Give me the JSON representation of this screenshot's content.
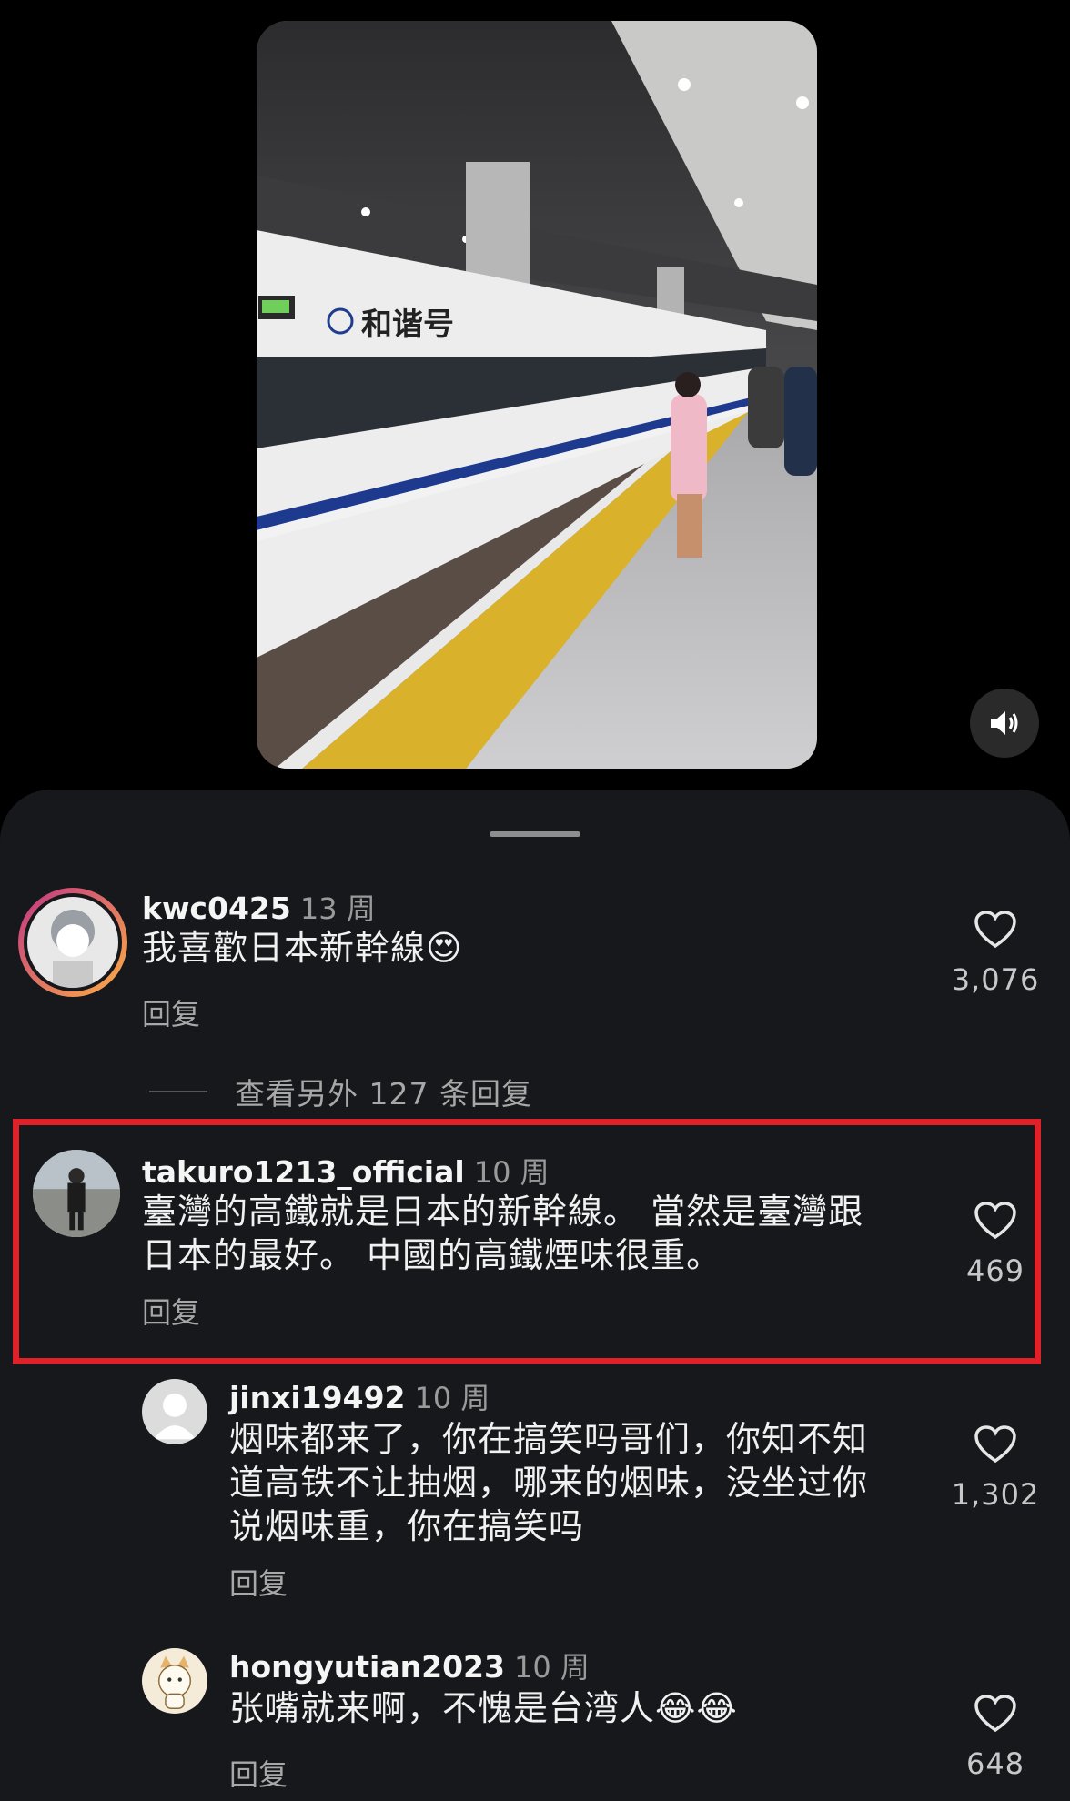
{
  "video": {
    "train_name": "和谐号",
    "sound_icon": "speaker-icon"
  },
  "comments": [
    {
      "username": "kwc0425",
      "time": "13 周",
      "text": "我喜歡日本新幹線😍",
      "reply_label": "回复",
      "likes": "3,076"
    },
    {
      "username": "takuro1213_official",
      "time": "10 周",
      "text_lines": [
        "臺灣的高鐵就是日本的新幹線。 當然是臺灣跟",
        "日本的最好。 中國的高鐵煙味很重。"
      ],
      "reply_label": "回复",
      "likes": "469",
      "highlighted": true
    },
    {
      "username": "jinxi19492",
      "time": "10 周",
      "text_lines": [
        "烟味都来了，你在搞笑吗哥们，你知不知",
        "道高铁不让抽烟，哪来的烟味，没坐过你",
        "说烟味重，你在搞笑吗"
      ],
      "reply_label": "回复",
      "likes": "1,302"
    },
    {
      "username": "hongyutian2023",
      "time": "10 周",
      "text": "张嘴就来啊，不愧是台湾人😂😂",
      "reply_label": "回复",
      "likes": "648"
    }
  ],
  "view_more_replies": "查看另外 127 条回复",
  "colors": {
    "background": "#000000",
    "sheet": "#17181b",
    "highlight_border": "#e1212a",
    "story_ring_start": "#c13584",
    "story_ring_end": "#fcaf45"
  }
}
